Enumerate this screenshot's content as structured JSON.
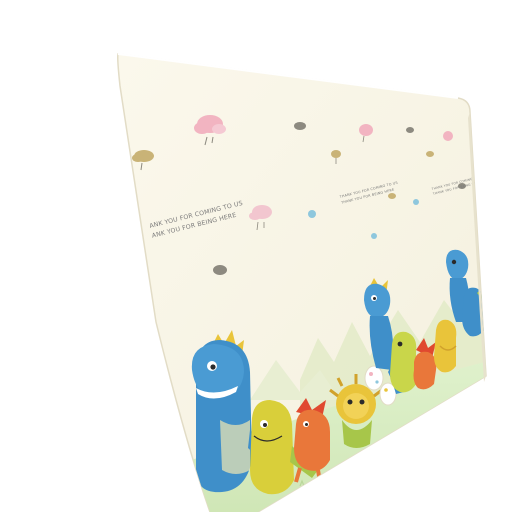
{
  "scene": {
    "subject": "dinosaur-printed-play-mat",
    "colors": {
      "background": "#ffffff",
      "mat_base": "#f7f4e4",
      "mat_edge": "#e9e5d0",
      "grass": "#d8edc2",
      "hills": "#e3ebc9",
      "accent_blue": "#3f8fc9",
      "accent_yellow": "#e9c43a",
      "accent_orange": "#e9773a",
      "cloud_pink": "#f2b4c1",
      "cloud_grey": "#8d8a80"
    }
  },
  "mat_text": {
    "left_line_1": "ANK YOU FOR COMING TO US",
    "left_line_2": "ANK YOU FOR BEING HERE",
    "center_line_1": "THANK YOU FOR COMING TO US",
    "center_line_2": "THANK YOU FOR BEING HERE",
    "right_line_1": "THANK YOU FOR COMING TO US",
    "right_line_2": "THANK YOU FOR BEING HERE"
  }
}
